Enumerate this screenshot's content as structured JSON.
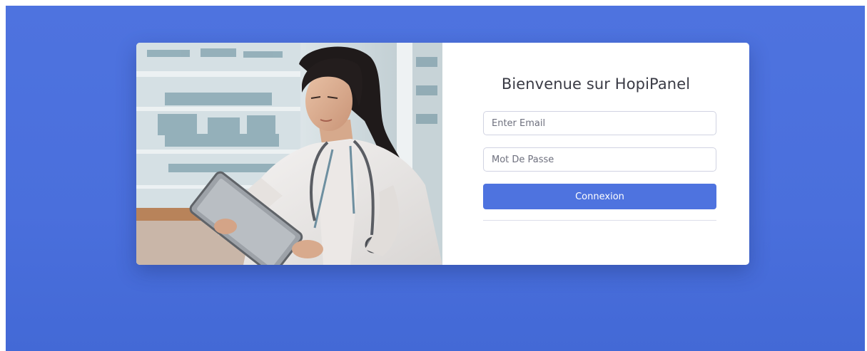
{
  "login": {
    "title": "Bienvenue sur HopiPanel",
    "email": {
      "placeholder": "Enter Email",
      "value": ""
    },
    "password": {
      "placeholder": "Mot De Passe",
      "value": ""
    },
    "submit_label": "Connexion"
  },
  "colors": {
    "background": "#4e73df",
    "button": "#4e73df",
    "card": "#ffffff",
    "title_text": "#3a3b45"
  },
  "image": {
    "subject": "doctor-with-tablet-photo"
  }
}
